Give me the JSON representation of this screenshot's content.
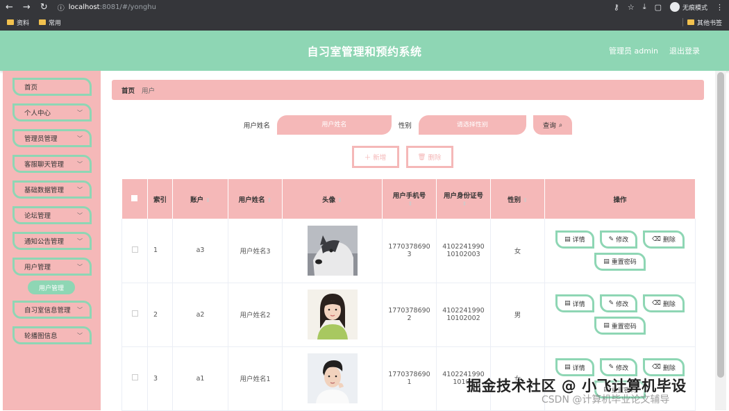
{
  "browser": {
    "url_host": "localhost",
    "url_path": ":8081/#/yonghu",
    "incognito_label": "无痕模式",
    "bookmarks": [
      "资料",
      "常用"
    ],
    "other_bookmarks": "其他书签"
  },
  "header": {
    "title": "自习室管理和预约系统",
    "user": "管理员 admin",
    "logout": "退出登录"
  },
  "sidebar": {
    "items": [
      {
        "label": "首页",
        "has_sub": false
      },
      {
        "label": "个人中心",
        "has_sub": true
      },
      {
        "label": "管理员管理",
        "has_sub": true
      },
      {
        "label": "客服聊天管理",
        "has_sub": true
      },
      {
        "label": "基础数据管理",
        "has_sub": true
      },
      {
        "label": "论坛管理",
        "has_sub": true
      },
      {
        "label": "通知公告管理",
        "has_sub": true
      },
      {
        "label": "用户管理",
        "has_sub": true
      }
    ],
    "active_sub": "用户管理",
    "items_after": [
      {
        "label": "自习室信息管理",
        "has_sub": true
      },
      {
        "label": "轮播图信息",
        "has_sub": true
      }
    ]
  },
  "breadcrumb": {
    "home": "首页",
    "current": "用户"
  },
  "search": {
    "name_label": "用户姓名",
    "name_placeholder": "用户姓名",
    "gender_label": "性别",
    "gender_placeholder": "请选择性别",
    "query_label": "查询"
  },
  "actions": {
    "add": "新增",
    "delete": "删除"
  },
  "table": {
    "headers": {
      "index": "索引",
      "account": "账户",
      "name": "用户姓名",
      "avatar": "头像",
      "phone": "用户手机号",
      "idcard": "用户身份证号",
      "gender": "性别",
      "ops": "操作"
    },
    "rows": [
      {
        "index": "1",
        "account": "a3",
        "name": "用户姓名3",
        "phone1": "1770378690",
        "phone2": "3",
        "id1": "4102241990",
        "id2": "10102003",
        "gender": "女",
        "avatar": "husky"
      },
      {
        "index": "2",
        "account": "a2",
        "name": "用户姓名2",
        "phone1": "1770378690",
        "phone2": "2",
        "id1": "4102241990",
        "id2": "10102002",
        "gender": "男",
        "avatar": "girl"
      },
      {
        "index": "3",
        "account": "a1",
        "name": "用户姓名1",
        "phone1": "1770378690",
        "phone2": "1",
        "id1": "4102241990",
        "id2": "10102",
        "gender": "女",
        "avatar": "boy"
      }
    ],
    "op_labels": {
      "detail": "详情",
      "edit": "修改",
      "delete": "删除",
      "reset": "重置密码"
    }
  },
  "watermark": {
    "main": "掘金技术社区 @ 小飞计算机毕设",
    "sub": "CSDN @计算机毕业论文辅导"
  },
  "colors": {
    "mint": "#8ed6b4",
    "pink": "#f5b8b8",
    "chrome": "#35363a"
  }
}
